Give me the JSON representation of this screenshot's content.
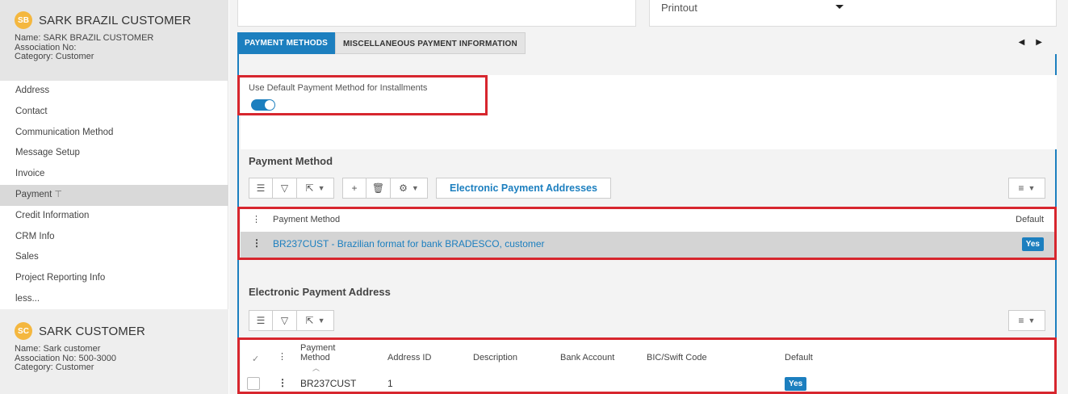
{
  "sidebar": {
    "customer1": {
      "initials": "SB",
      "title": "SARK BRAZIL CUSTOMER",
      "name_line": "Name:  SARK BRAZIL CUSTOMER",
      "assoc_line": "Association No:",
      "category_line": "Category:  Customer"
    },
    "items": [
      {
        "label": "Address"
      },
      {
        "label": "Contact"
      },
      {
        "label": "Communication Method"
      },
      {
        "label": "Message Setup"
      },
      {
        "label": "Invoice"
      },
      {
        "label": "Payment",
        "pin": "⊤"
      },
      {
        "label": "Credit Information"
      },
      {
        "label": "CRM Info"
      },
      {
        "label": "Sales"
      },
      {
        "label": "Project Reporting Info"
      },
      {
        "label": "less..."
      }
    ],
    "customer2": {
      "initials": "SC",
      "title": "SARK CUSTOMER",
      "name_line": "Name:  Sark customer",
      "assoc_line": "Association No:  500-3000",
      "category_line": "Category:  Customer"
    }
  },
  "header": {
    "select_value": "Printout"
  },
  "tabs": [
    {
      "label": "PAYMENT METHODS"
    },
    {
      "label": "MISCELLANEOUS PAYMENT INFORMATION"
    }
  ],
  "tab_nav": {
    "prev": "◀",
    "next": "▶"
  },
  "toggle": {
    "label": "Use Default Payment Method for Installments",
    "state": "on"
  },
  "payment_method": {
    "section_title": "Payment Method",
    "electronic_button": "Electronic Payment Addresses",
    "columns": {
      "name": "Payment Method",
      "default": "Default"
    },
    "rows": [
      {
        "method": "BR237CUST - Brazilian format for bank BRADESCO, customer",
        "default": "Yes"
      }
    ]
  },
  "electronic_address": {
    "section_title": "Electronic Payment Address",
    "columns": {
      "payment_method_1": "Payment",
      "payment_method_2": "Method",
      "address_id": "Address ID",
      "description": "Description",
      "bank_account": "Bank Account",
      "bic": "BIC/Swift Code",
      "default": "Default"
    },
    "rows": [
      {
        "method": "BR237CUST",
        "address_id": "1",
        "description": "",
        "bank_account": "",
        "bic": "",
        "default": "Yes"
      }
    ]
  },
  "colors": {
    "accent": "#1c7fbf",
    "highlight": "#d7262e",
    "avatar": "#f4b73f"
  }
}
